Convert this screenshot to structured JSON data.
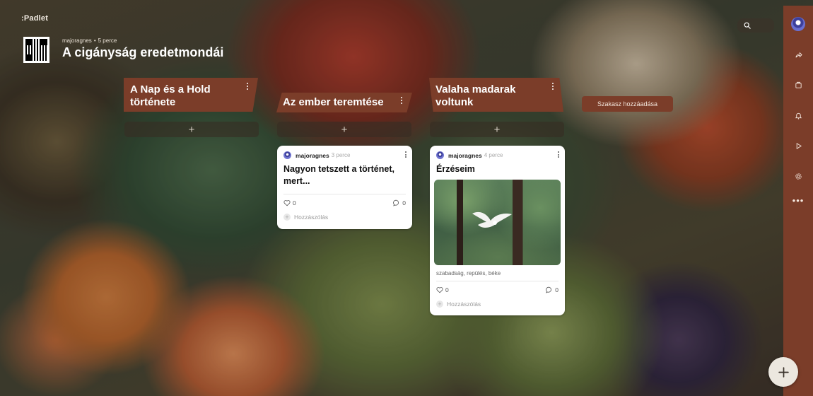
{
  "brand": ":Padlet",
  "board": {
    "author": "majoragnes",
    "time": "5 perce",
    "title": "A cigányság eredetmondái"
  },
  "sections": [
    {
      "title": "A Nap és a Hold története"
    },
    {
      "title": "Az ember teremtése"
    },
    {
      "title": "Valaha madarak voltunk"
    }
  ],
  "add_post_symbol": "+",
  "add_section_label": "Szakasz hozzáadása",
  "posts": [
    {
      "author": "majoragnes",
      "time": "3 perce",
      "title": "Nagyon tetszett a történet, mert...",
      "likes": "0",
      "comments": "0",
      "comment_placeholder": "Hozzászólás"
    },
    {
      "author": "majoragnes",
      "time": "4 perce",
      "title": "Érzéseim",
      "tags": "szabadság, repülés, béke",
      "likes": "0",
      "comments": "0",
      "comment_placeholder": "Hozzászólás",
      "image": "dove-photo"
    }
  ],
  "sidebar": {
    "icons": [
      "share-icon",
      "remake-icon",
      "bell-icon",
      "play-icon",
      "settings-icon",
      "more-icon"
    ],
    "more_label": "•••"
  },
  "colors": {
    "accent": "#7b3d29",
    "card": "#ffffff"
  }
}
